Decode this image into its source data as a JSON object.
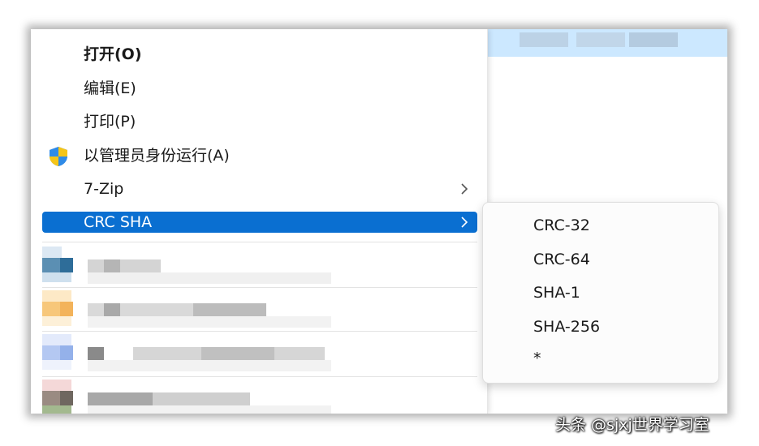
{
  "menu": {
    "items": [
      {
        "label": "打开(O)",
        "bold": true
      },
      {
        "label": "编辑(E)"
      },
      {
        "label": "打印(P)"
      },
      {
        "label": "以管理员身份运行(A)",
        "icon": "shield-icon"
      },
      {
        "label": "7-Zip",
        "submenu": true
      },
      {
        "label": "CRC SHA",
        "submenu": true,
        "highlighted": true
      }
    ]
  },
  "submenu": {
    "items": [
      {
        "label": "CRC-32"
      },
      {
        "label": "CRC-64"
      },
      {
        "label": "SHA-1"
      },
      {
        "label": "SHA-256"
      },
      {
        "label": "*"
      }
    ]
  },
  "colors": {
    "highlight": "#0a6fd1",
    "selection_row": "#cce8ff",
    "shield_blue": "#1e6fd0",
    "shield_yellow": "#f5c518"
  },
  "watermark": "头条 @sjxj世界学习室"
}
